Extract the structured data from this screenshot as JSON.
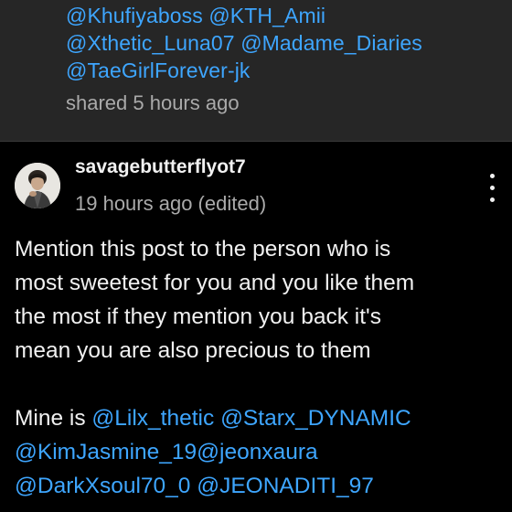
{
  "shared_post": {
    "mentions_line1": [
      "@Khufiyaboss",
      "@KTH_Amii"
    ],
    "mentions_line2": [
      "@Xthetic_Luna07",
      "@Madame_Diaries"
    ],
    "mentions_line3": [
      "@TaeGirlForever-jk"
    ],
    "shared_time": "shared 5 hours ago"
  },
  "post": {
    "username": "savagebutterflyot7",
    "time": "19 hours ago (edited)",
    "body_lines": [
      "Mention this post to the person who is",
      "most sweetest for you and you like them",
      "the most if they mention you back it's",
      "mean you are also precious to them"
    ],
    "mine_prefix": "Mine is",
    "mine_line1": [
      "@Lilx_thetic",
      "@Starx_DYNAMIC"
    ],
    "mine_line2": [
      "@KimJasmine_19",
      "@jeonxaura"
    ],
    "mine_line3": [
      "@DarkXsoul70_0",
      "@JEONADITI_97"
    ]
  },
  "icons": {
    "menu": "more-vert-icon",
    "avatar": "user-avatar"
  },
  "colors": {
    "background": "#000000",
    "card_background": "#262626",
    "link": "#3ea6ff",
    "text": "#f1f1f1",
    "muted": "#aaaaaa"
  }
}
